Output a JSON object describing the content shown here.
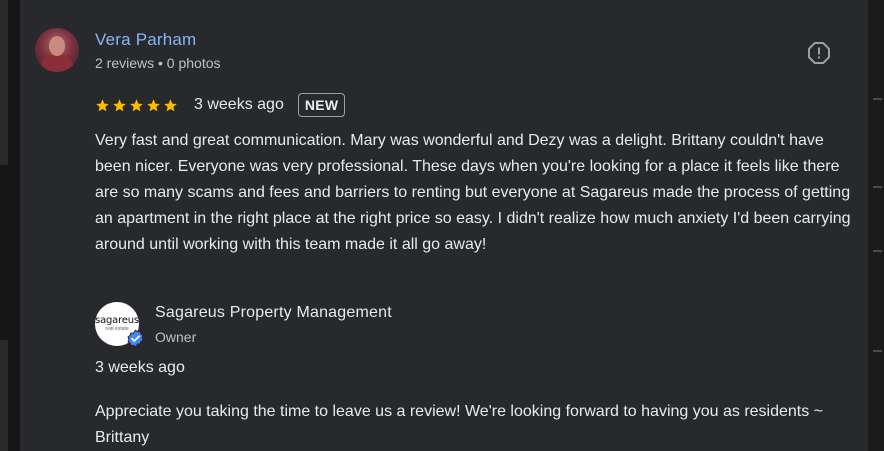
{
  "reviewer": {
    "name": "Vera Parham",
    "meta": "2 reviews • 0 photos",
    "avatar_icon": "user-photo"
  },
  "flag": {
    "icon": "flag-report-icon"
  },
  "review": {
    "rating": 5,
    "rating_max": 5,
    "star_color": "#fbbc04",
    "time": "3 weeks ago",
    "badge": "NEW",
    "text": "Very fast and great communication. Mary was wonderful and Dezy was a delight. Brittany couldn't have been nicer. Everyone was very professional. These days when you're looking for a place it feels like there are so many scams and fees and barriers to renting but everyone at Sagareus made the process of getting an apartment in the right place at the right price so easy. I didn't realize how much anxiety I'd been carrying around until working with this team made it all go away!"
  },
  "owner": {
    "logo_text": "sagareus",
    "logo_subtext": "real estate",
    "name": "Sagareus Property Management",
    "role": "Owner",
    "verified_icon": "verified-check-icon",
    "verified_color": "#4285f4",
    "reply_time": "3 weeks ago",
    "reply_text": "Appreciate you taking the time to leave us a review! We're looking forward to having you as residents ~ Brittany"
  },
  "colors": {
    "background": "#28292c",
    "link": "#8ab4f8",
    "text": "#e8eaed",
    "muted": "#bdc1c6"
  }
}
